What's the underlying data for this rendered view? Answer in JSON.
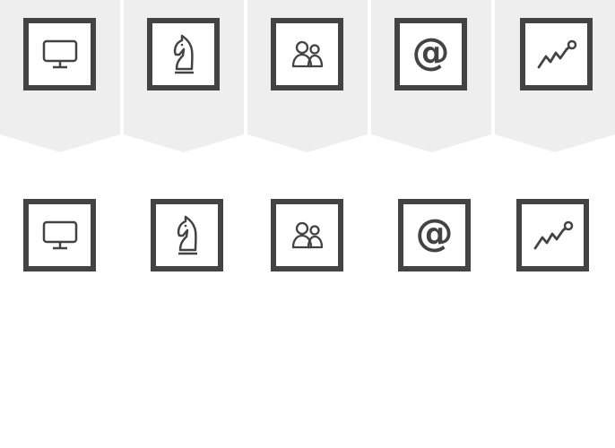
{
  "colors": {
    "ribbon": "#eeeeee",
    "border": "#434343",
    "icon": "#434343",
    "background": "#ffffff"
  },
  "top_row": {
    "items": [
      {
        "icon": "monitor-icon"
      },
      {
        "icon": "chess-knight-icon"
      },
      {
        "icon": "users-icon"
      },
      {
        "icon": "at-sign-icon",
        "glyph": "@"
      },
      {
        "icon": "line-chart-icon"
      }
    ]
  },
  "bottom_row": {
    "items": [
      {
        "icon": "monitor-icon"
      },
      {
        "icon": "chess-knight-icon"
      },
      {
        "icon": "users-icon"
      },
      {
        "icon": "at-sign-icon",
        "glyph": "@"
      },
      {
        "icon": "line-chart-icon"
      }
    ]
  }
}
